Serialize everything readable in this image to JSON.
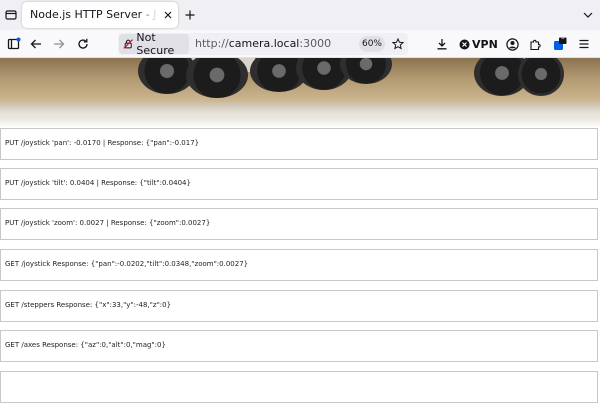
{
  "browser": {
    "tab": {
      "title": "Node.js HTTP Server - Joystick P"
    },
    "toolbar": {
      "not_secure_label": "Not Secure",
      "url_scheme": "http://",
      "url_host": "camera.local",
      "url_port": ":3000",
      "zoom_level": "60%",
      "vpn_label": "VPN",
      "extensions_badge": "0"
    }
  },
  "log_entries": [
    {
      "text": "PUT /joystick 'pan': -0.0170 | Response: {\"pan\":-0.017}"
    },
    {
      "text": "PUT /joystick 'tilt': 0.0404 | Response: {\"tilt\":0.0404}"
    },
    {
      "text": "PUT /joystick 'zoom': 0.0027 | Response: {\"zoom\":0.0027}"
    },
    {
      "text": "GET /joystick Response: {\"pan\":-0.0202,\"tilt\":0.0348,\"zoom\":0.0027}"
    },
    {
      "text": "GET /steppers Response: {\"x\":33,\"y\":-48,\"z\":0}"
    },
    {
      "text": "GET /axes Response: {\"az\":0,\"alt\":0,\"mag\":0}"
    },
    {
      "text": ""
    }
  ]
}
